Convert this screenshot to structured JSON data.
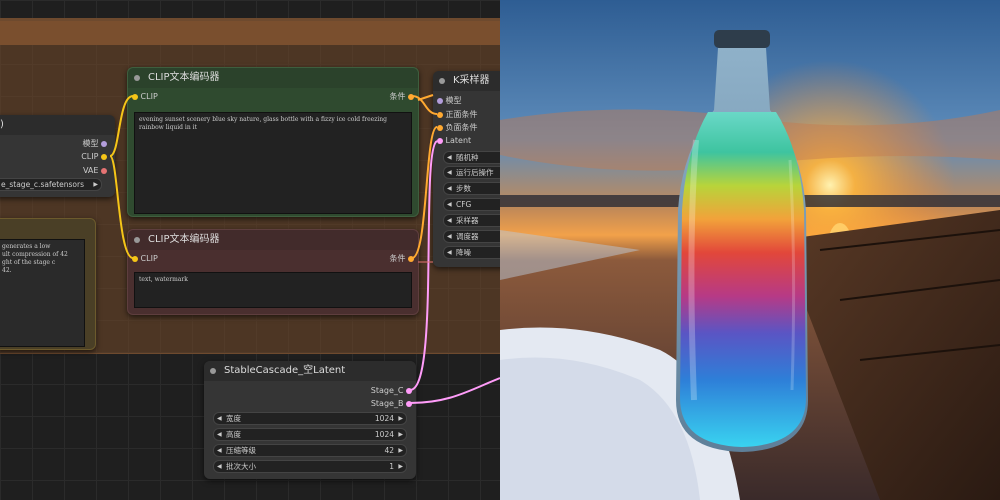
{
  "canvas": {
    "left_node": {
      "inputs": [
        "模型",
        "CLIP",
        "VAE"
      ],
      "ckpt": "e_stage_c.safetensors",
      "note_lines": "generates a low\nult compression of 42\nght of the stage c\n42."
    },
    "clip_pos": {
      "title": "CLIP文本编码器",
      "in_label": "CLIP",
      "out_label": "条件",
      "text": "evening sunset scenery blue sky nature, glass bottle with a fizzy ice cold freezing rainbow liquid in it"
    },
    "clip_neg": {
      "title": "CLIP文本编码器",
      "in_label": "CLIP",
      "out_label": "条件",
      "text": "text, watermark"
    },
    "ksampler": {
      "title": "K采样器",
      "inputs": [
        "模型",
        "正面条件",
        "负面条件",
        "Latent"
      ],
      "widgets": [
        "随机种",
        "运行后操作",
        "步数",
        "CFG",
        "采样器",
        "调度器",
        "降噪"
      ]
    },
    "latent": {
      "title": "StableCascade_空Latent",
      "outputs": [
        "Stage_C",
        "Stage_B"
      ],
      "widgets": [
        {
          "label": "宽度",
          "value": "1024"
        },
        {
          "label": "高度",
          "value": "1024"
        },
        {
          "label": "压缩等级",
          "value": "42"
        },
        {
          "label": "批次大小",
          "value": "1"
        }
      ]
    },
    "colors": {
      "clip_pin": "#f5c518",
      "model_pin": "#b39ddb",
      "vae_pin": "#e57373",
      "cond_pin": "#ffa931",
      "latent_pin": "#ff9cf9"
    }
  },
  "image": {
    "description_icon": "rainbow-liquid-bottle-sunset"
  }
}
